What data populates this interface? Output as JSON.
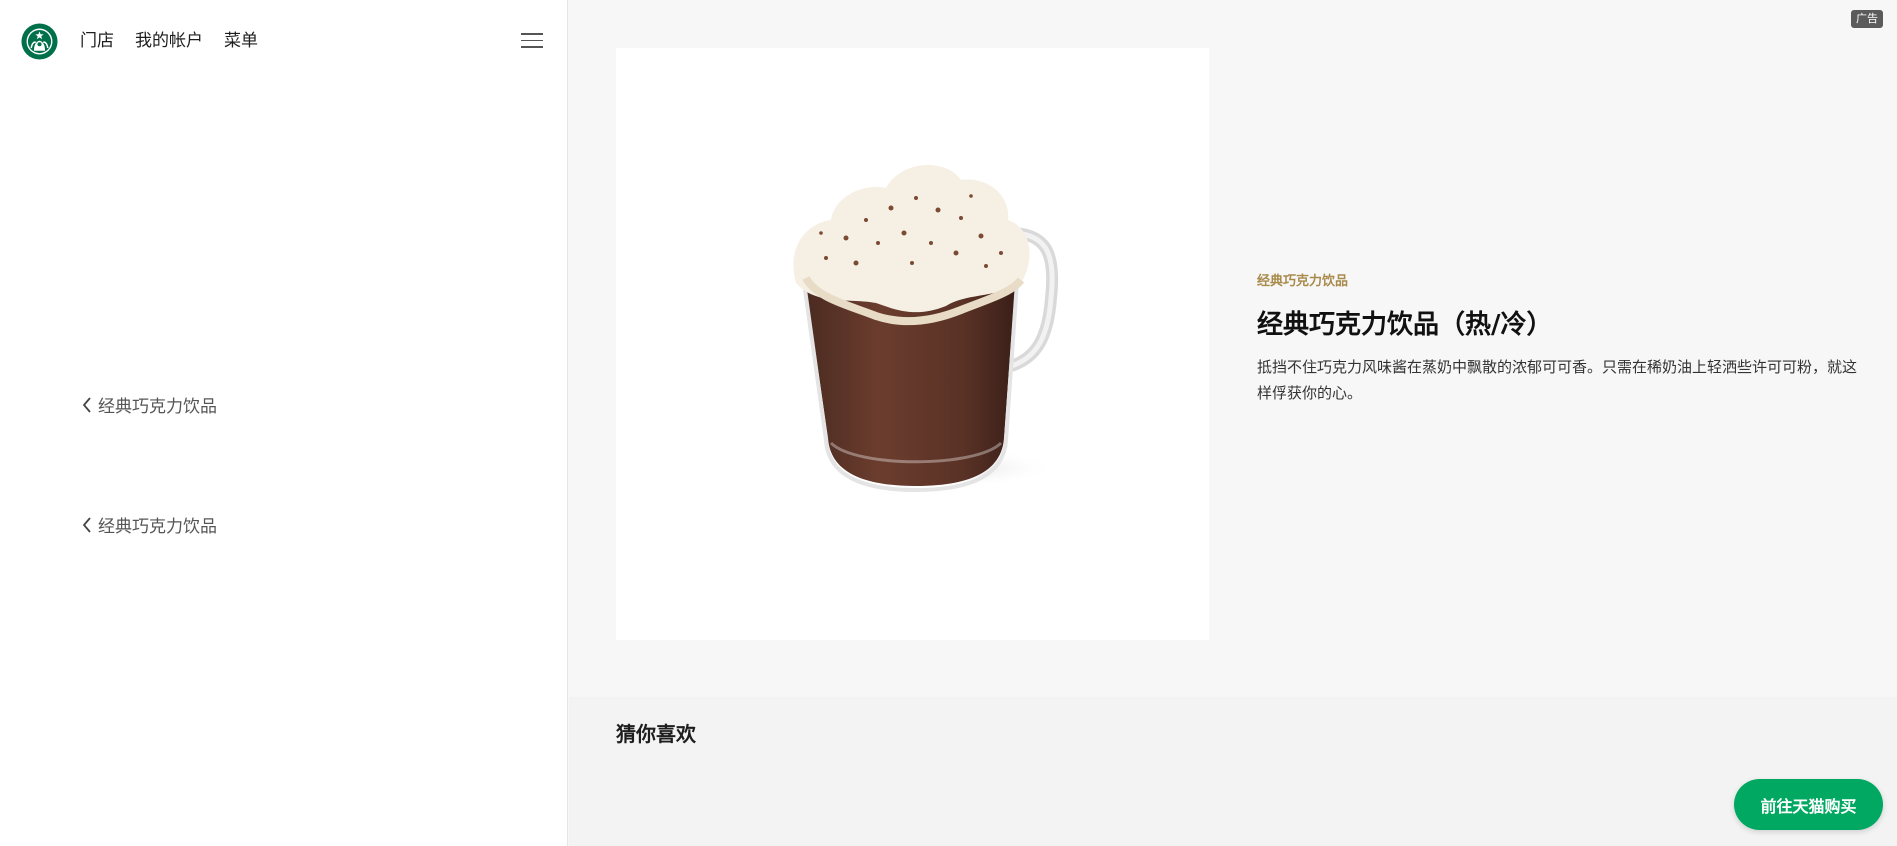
{
  "nav": {
    "links": [
      "门店",
      "我的帐户",
      "菜单"
    ]
  },
  "sidebar": {
    "back_links": [
      "经典巧克力饮品",
      "经典巧克力饮品"
    ]
  },
  "ad_badge": "广告",
  "product": {
    "category": "经典巧克力饮品",
    "title": "经典巧克力饮品（热/冷）",
    "description": "抵挡不住巧克力风味酱在蒸奶中飘散的浓郁可可香。只需在稀奶油上轻洒些许可可粉，就这样俘获你的心。"
  },
  "recommend": {
    "title": "猜你喜欢"
  },
  "buy_button": "前往天猫购买",
  "colors": {
    "brand_green": "#00a862",
    "logo_green": "#00704a",
    "category_gold": "#a88a4a"
  },
  "icons": [
    "starbucks-logo",
    "hamburger-menu-icon",
    "chevron-left-icon",
    "hot-chocolate-product-image"
  ]
}
